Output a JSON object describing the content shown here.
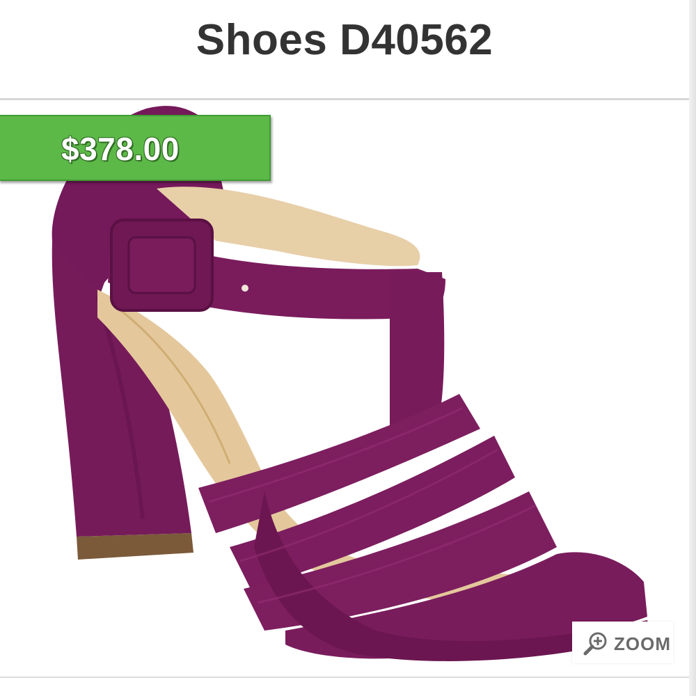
{
  "product": {
    "title": "Shoes D40562",
    "price": "$378.00",
    "image_subject": "purple-suede-block-heel-t-strap-sandal"
  },
  "zoom": {
    "label": "ZOOM",
    "icon": "zoom-in-magnifier-icon"
  },
  "colors": {
    "price_badge": "#5cb947",
    "shoe_suede": "#7a1c5c",
    "title_text": "#333333"
  }
}
